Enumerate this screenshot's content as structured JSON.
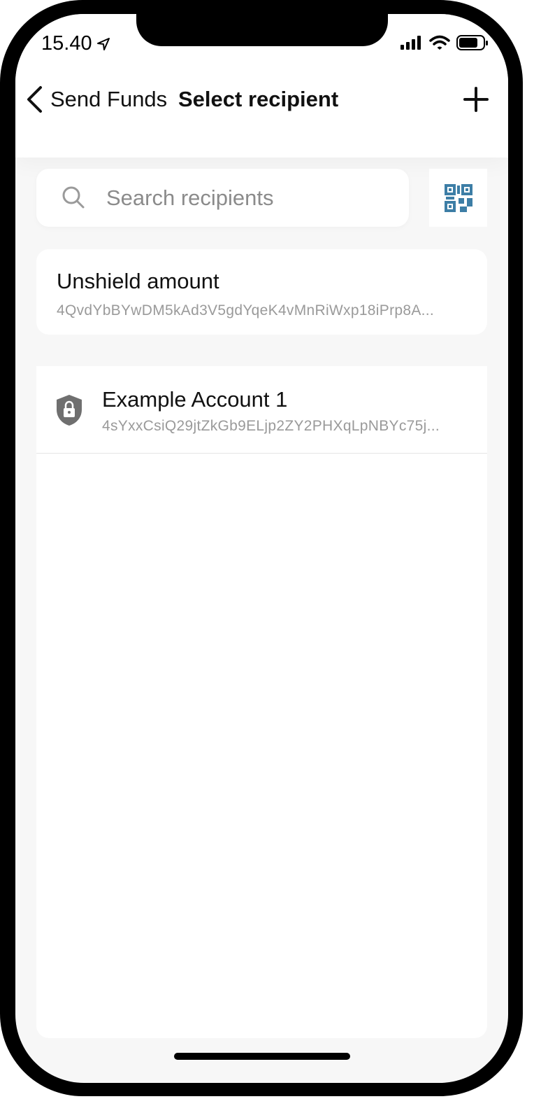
{
  "status_bar": {
    "time": "15.40",
    "icons": [
      "location-arrow-icon",
      "cellular-signal-icon",
      "wifi-icon",
      "battery-icon"
    ]
  },
  "header": {
    "back_label": "Send Funds",
    "title": "Select recipient",
    "add_icon": "plus-icon"
  },
  "search": {
    "placeholder": "Search recipients",
    "value": "",
    "icon": "search-icon"
  },
  "qr_button": {
    "icon": "qr-code-icon",
    "color": "#3d7ea6"
  },
  "unshield": {
    "title": "Unshield amount",
    "address": "4QvdYbBYwDM5kAd3V5gdYqeK4vMnRiWxp18iPrp8A..."
  },
  "recipients": [
    {
      "name": "Example Account 1",
      "address": "4sYxxCsiQ29jtZkGb9ELjp2ZY2PHXqLpNBYc75j...",
      "icon": "shield-lock-icon"
    }
  ]
}
